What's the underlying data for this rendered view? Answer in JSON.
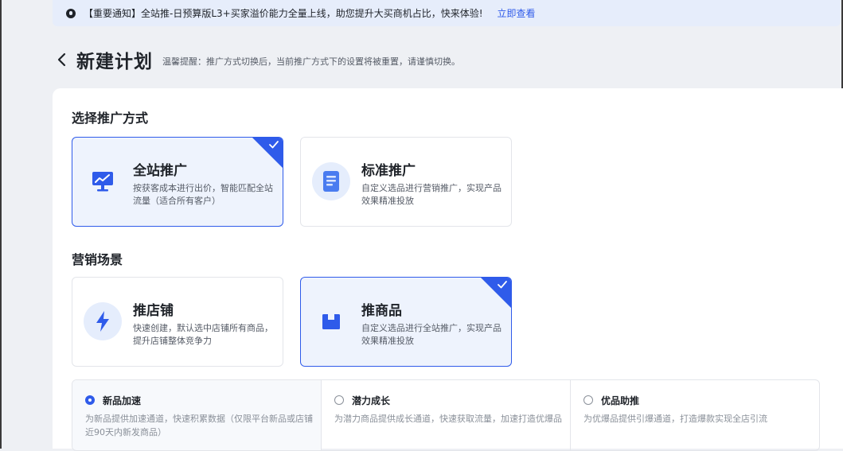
{
  "notice": {
    "text": "【重要通知】全站推-日预算版L3+买家溢价能力全量上线，助您提升大买商机占比，快来体验!",
    "link": "立即查看"
  },
  "header": {
    "title": "新建计划",
    "tip": "温馨提醒：推广方式切换后，当前推广方式下的设置将被重置，请谨慎切换。"
  },
  "promotion": {
    "section_title": "选择推广方式",
    "cards": [
      {
        "title": "全站推广",
        "desc": "按获客成本进行出价，智能匹配全站流量（适合所有客户）",
        "icon": "monitor-chart-icon",
        "selected": true
      },
      {
        "title": "标准推广",
        "desc": "自定义选品进行营销推广，实现产品效果精准投放",
        "icon": "document-icon",
        "selected": false
      }
    ]
  },
  "scene": {
    "section_title": "营销场景",
    "cards": [
      {
        "title": "推店铺",
        "desc": "快速创建，默认选中店铺所有商品，提升店铺整体竞争力",
        "icon": "lightning-icon",
        "selected": false
      },
      {
        "title": "推商品",
        "desc": "自定义选品进行全站推广，实现产品效果精准投放",
        "icon": "box-icon",
        "selected": true
      }
    ]
  },
  "options": [
    {
      "title": "新品加速",
      "desc": "为新品提供加速通道，快速积累数据（仅限平台新品或店铺近90天内新发商品）",
      "selected": true
    },
    {
      "title": "潜力成长",
      "desc": "为潜力商品提供成长通道，快速获取流量，加速打造优爆品",
      "selected": false
    },
    {
      "title": "优品助推",
      "desc": "为优爆品提供引爆通道，打造爆款实现全店引流",
      "selected": false
    }
  ],
  "colors": {
    "accent": "#2f5bea",
    "selected_bg": "#eef3fd",
    "notice_bg": "#e6edfb"
  }
}
